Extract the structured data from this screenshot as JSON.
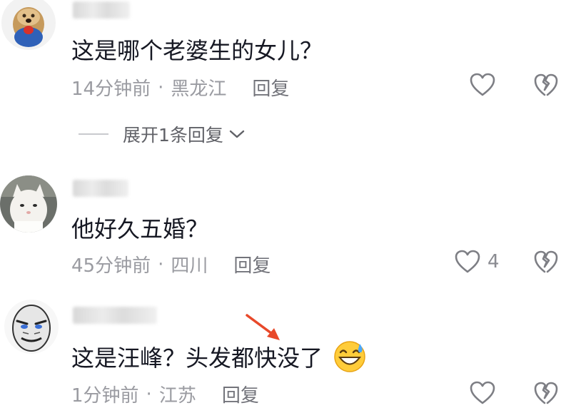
{
  "comments": [
    {
      "text": "这是哪个老婆生的女儿？",
      "time": "14分钟前",
      "location": "黑龙江",
      "reply_label": "回复",
      "likes": "",
      "expand_label": "展开1条回复"
    },
    {
      "text": "他好久五婚？",
      "time": "45分钟前",
      "location": "四川",
      "reply_label": "回复",
      "likes": "4"
    },
    {
      "text": "这是汪峰？头发都快没了",
      "time": "1分钟前",
      "location": "江苏",
      "reply_label": "回复",
      "likes": ""
    }
  ],
  "separator": "·",
  "icons": {
    "like": "heart-outline-icon",
    "dislike": "broken-heart-icon",
    "expand": "chevron-down-icon",
    "emoji": "grinning-sweat-emoji"
  },
  "colors": {
    "text": "#161823",
    "meta": "#9a9ba1",
    "annotation_arrow": "#e8492a"
  }
}
